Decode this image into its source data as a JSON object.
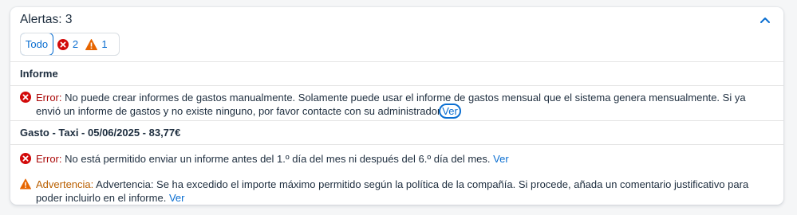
{
  "header": {
    "title": "Alertas: 3"
  },
  "filters": {
    "all_label": "Todo",
    "error_count": "2",
    "warning_count": "1"
  },
  "groups": [
    {
      "title": "Informe",
      "messages": [
        {
          "type": "error",
          "label": "Error:",
          "text": "No puede crear informes de gastos manualmente. Solamente puede usar el informe de gastos mensual que el sistema genera mensualmente. Si ya envió un informe de gastos y no existe ninguno, por favor contacte con su administrador",
          "link": "Ver"
        }
      ]
    },
    {
      "title": "Gasto - Taxi - 05/06/2025 - 83,77€",
      "messages": [
        {
          "type": "error",
          "label": "Error:",
          "text": "No está permitido enviar un informe antes del 1.º día del mes ni después del 6.º día del mes.",
          "link": "Ver"
        },
        {
          "type": "warning",
          "label": "Advertencia:",
          "text": "Advertencia: Se ha excedido el importe máximo permitido según la política de la compañía. Si procede, añada un comentario justificativo para poder incluirlo en el informe.",
          "link": "Ver"
        }
      ]
    }
  ],
  "colors": {
    "error": "#d20a0a",
    "warning": "#e76500",
    "link": "#0a6ed1"
  }
}
